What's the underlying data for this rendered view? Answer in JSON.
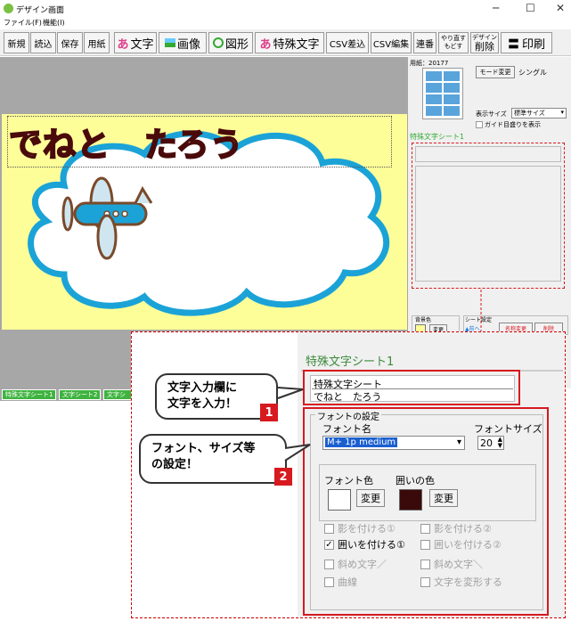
{
  "window": {
    "title": "デザイン画面",
    "min": "─",
    "max": "☐",
    "close": "✕"
  },
  "menu": [
    "ファイル(F)",
    "機能(I)"
  ],
  "toolbar": {
    "new": "新規",
    "open": "読込",
    "save": "保存",
    "paper": "用紙",
    "text_icon": "あ",
    "text": "文字",
    "image": "画像",
    "shape": "図形",
    "special_icon": "あ",
    "special": "特殊文字",
    "csv_insert": "CSV差込",
    "csv_edit": "CSV編集",
    "serial": "連番",
    "undo": "やり直す",
    "redo": "もどす",
    "del_top": "デザイン",
    "del": "削除",
    "print": "印刷"
  },
  "canvas": {
    "text": "でねと　たろう"
  },
  "tabs": [
    "特殊文字シート1",
    "文字シート2",
    "文字シ"
  ],
  "right": {
    "paper_label": "用紙：20177",
    "mode_button": "モード変更",
    "mode_value": "シングル",
    "display_size_label": "表示サイズ",
    "display_size_value": "標準サイズ",
    "guide_label": "ガイド目盛りを表示",
    "sheet_title": "特殊文字シート1",
    "bg_label": "背景色",
    "bg_button": "変更",
    "sheet_group": "シート設定",
    "up": "▲前へ",
    "rename": "名称変更",
    "delete": "削除"
  },
  "panel": {
    "title": "特殊文字シート1",
    "input_label": "特殊文字シート",
    "input_value": "でねと　たろう",
    "font_group": "フォントの設定",
    "font_name_label": "フォント名",
    "font_size_label": "フォントサイズ",
    "font_name": "M+ 1p medium",
    "font_size": "20",
    "font_color_label": "フォント色",
    "outline_color_label": "囲いの色",
    "change": "変更",
    "shadow1": "影を付ける①",
    "shadow2": "影を付ける②",
    "outline1": "囲いを付ける①",
    "outline2": "囲いを付ける②",
    "slant1": "斜め文字／",
    "slant2": "斜め文字＼",
    "curve": "曲線",
    "transform": "文字を変形する",
    "font_color": "#ffffff",
    "outline_color": "#3a0a0a"
  },
  "callouts": {
    "c1": "文字入力欄に\n文字を入力！",
    "c1_no": "1",
    "c2": "フォント、サイズ等\nの設定！",
    "c2_no": "2"
  },
  "colors": {
    "accent": "#d71920",
    "green": "#3fb33f",
    "paper": "#fefe99"
  }
}
